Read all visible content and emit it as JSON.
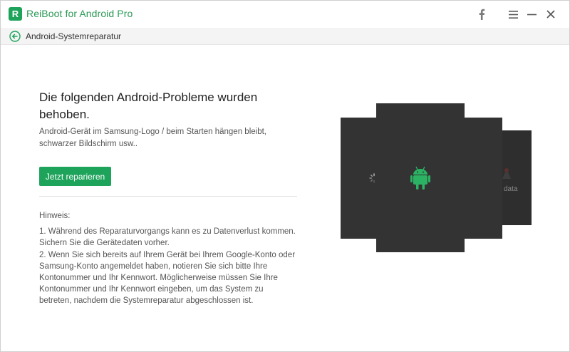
{
  "app": {
    "title": "ReiBoot for Android Pro",
    "logo_letter": "R"
  },
  "titlebar": {
    "icons": [
      "facebook-icon",
      "menu-icon",
      "minimize-icon",
      "close-icon"
    ]
  },
  "breadcrumb": {
    "label": "Android-Systemreparatur"
  },
  "main": {
    "headline": "Die folgenden Android-Probleme wurden behoben.",
    "description": "Android-Gerät im Samsung-Logo / beim Starten hängen bleibt, schwarzer Bildschirm usw..",
    "repair_button": "Jetzt reparieren",
    "notes_label": "Hinweis:",
    "notes": [
      "1. Während des Reparaturvorgangs kann es zu Datenverlust kommen. Sichern Sie die Gerätedaten vorher.",
      "2. Wenn Sie sich bereits auf Ihrem Gerät bei Ihrem Google-Konto oder Samsung-Konto angemeldet haben, notieren Sie sich bitte Ihre Kontonummer und Ihr Kennwort. Möglicherweise müssen Sie Ihre Kontonummer und Ihr Kennwort eingeben, um das System zu betreten, nachdem die Systemreparatur abgeschlossen ist."
    ]
  },
  "illustration": {
    "data_label": "data"
  },
  "colors": {
    "brand_green": "#1ea35b",
    "phone_dark": "#333333",
    "android_green": "#2bb363"
  }
}
